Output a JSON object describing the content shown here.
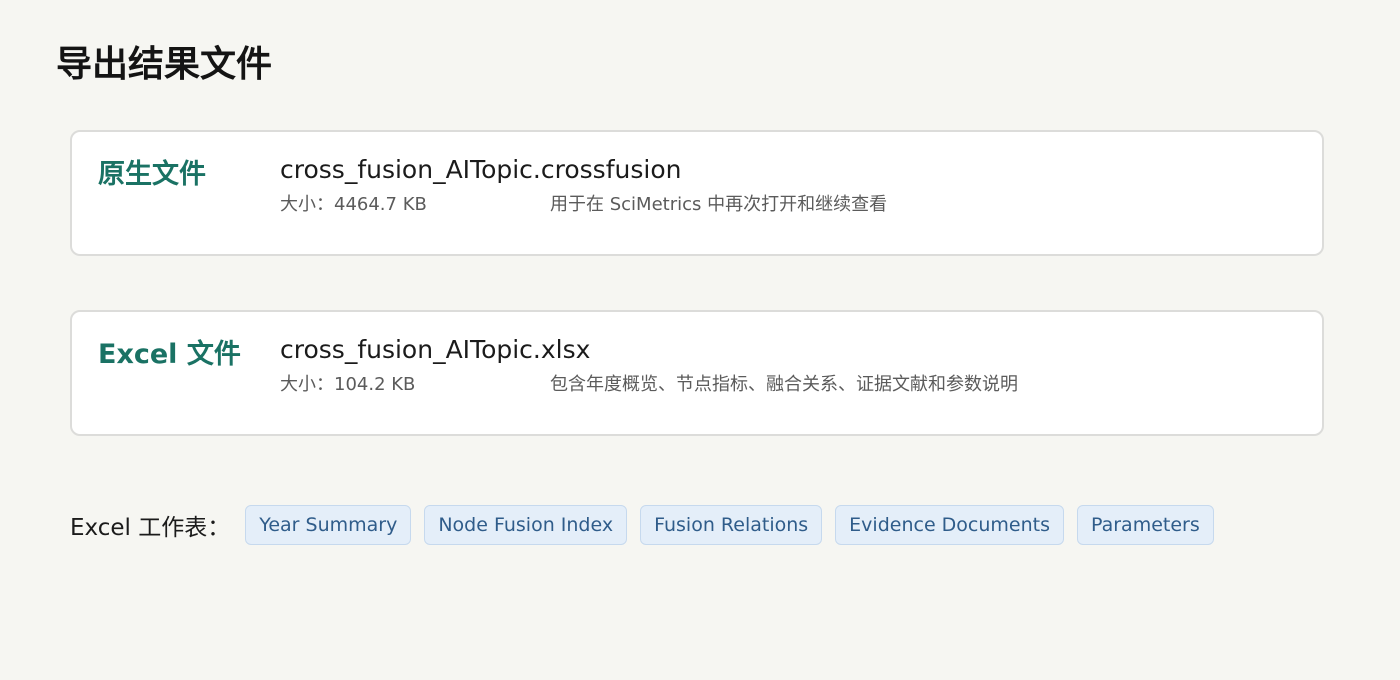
{
  "header": {
    "title": "导出结果文件"
  },
  "files": [
    {
      "label": "原生文件",
      "name": "cross_fusion_AITopic.crossfusion",
      "size": "大小：4464.7 KB",
      "description": "用于在 SciMetrics 中再次打开和继续查看"
    },
    {
      "label": "Excel 文件",
      "name": "cross_fusion_AITopic.xlsx",
      "size": "大小：104.2 KB",
      "description": "包含年度概览、节点指标、融合关系、证据文献和参数说明"
    }
  ],
  "sheets": {
    "label": "Excel 工作表：",
    "items": [
      "Year Summary",
      "Node Fusion Index",
      "Fusion Relations",
      "Evidence Documents",
      "Parameters"
    ]
  },
  "colors": {
    "background": "#f6f6f2",
    "accent": "#1a7264",
    "chip_background": "#e4eef9",
    "chip_text": "#2f5c8a"
  }
}
